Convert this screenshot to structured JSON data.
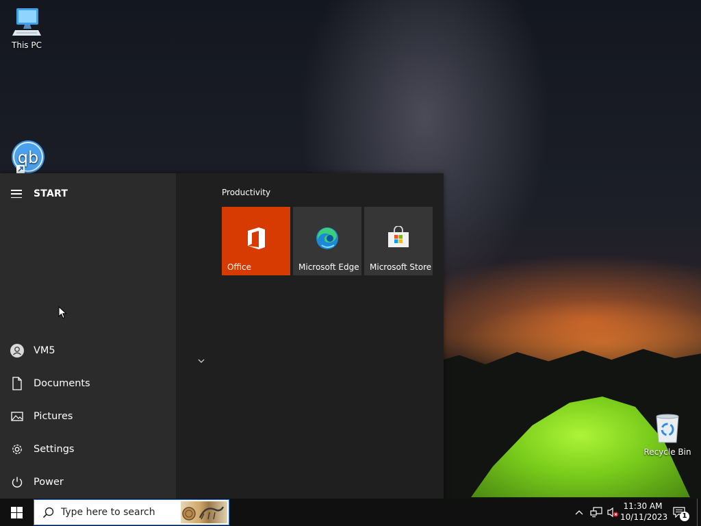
{
  "desktop": {
    "icons": [
      {
        "label": "This PC",
        "icon": "computer-icon"
      },
      {
        "label": "",
        "icon": "qbittorrent-icon"
      },
      {
        "label": "Recycle Bin",
        "icon": "recycle-bin-icon"
      }
    ]
  },
  "start_menu": {
    "title": "START",
    "nav_items": [
      {
        "label": "VM5",
        "icon": "user-icon"
      },
      {
        "label": "Documents",
        "icon": "document-icon"
      },
      {
        "label": "Pictures",
        "icon": "pictures-icon"
      },
      {
        "label": "Settings",
        "icon": "gear-icon"
      },
      {
        "label": "Power",
        "icon": "power-icon"
      }
    ],
    "group_title": "Productivity",
    "tiles": [
      {
        "label": "Office",
        "icon": "office-icon",
        "color": "#d83b01"
      },
      {
        "label": "Microsoft Edge",
        "icon": "edge-icon",
        "color": "#363636"
      },
      {
        "label": "Microsoft Store",
        "icon": "store-icon",
        "color": "#363636"
      }
    ]
  },
  "taskbar": {
    "search_placeholder": "Type here to search",
    "time": "11:30 AM",
    "date": "10/11/2023",
    "notification_count": "1"
  },
  "colors": {
    "start_left_bg": "#2b2b2b",
    "start_right_bg": "#1f1f1f",
    "office_tile": "#d83b01",
    "search_border": "#2b7fd6"
  }
}
